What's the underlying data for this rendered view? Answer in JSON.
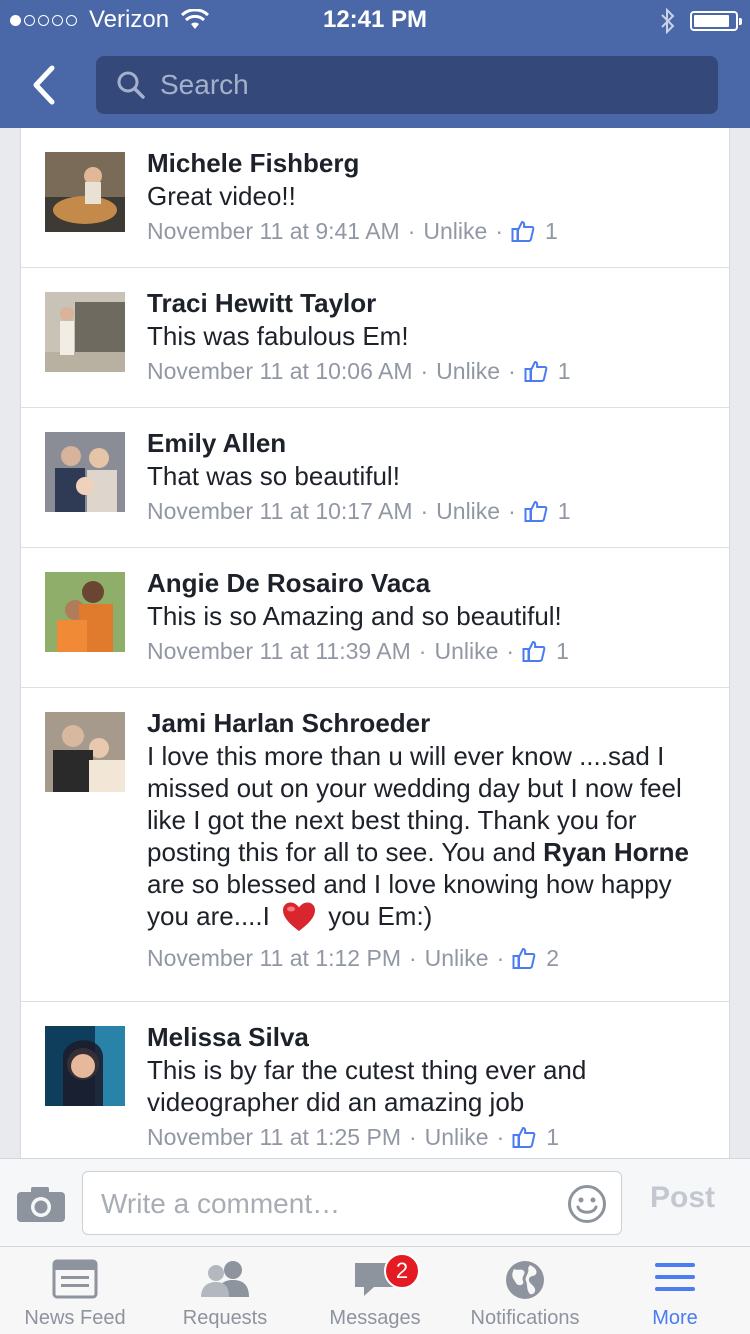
{
  "status_bar": {
    "carrier": "Verizon",
    "time": "12:41 PM",
    "signal_bars": 1,
    "signal_total": 5
  },
  "header": {
    "search_placeholder": "Search"
  },
  "comments": [
    {
      "author": "Michele Fishberg",
      "text": "Great video!!",
      "timestamp": "November 11 at 9:41 AM",
      "action": "Unlike",
      "likes": "1",
      "avatar_colors": [
        "#7a6a58",
        "#c48a4a",
        "#3d3a35"
      ]
    },
    {
      "author": "Traci Hewitt Taylor",
      "text": "This was fabulous Em!",
      "timestamp": "November 11 at 10:06 AM",
      "action": "Unlike",
      "likes": "1",
      "avatar_colors": [
        "#c9c2b6",
        "#e9d7c4",
        "#6e6a60"
      ]
    },
    {
      "author": "Emily Allen",
      "text": "That was so beautiful!",
      "timestamp": "November 11 at 10:17 AM",
      "action": "Unlike",
      "likes": "1",
      "avatar_colors": [
        "#8a8d95",
        "#d6b39a",
        "#2f3a55"
      ]
    },
    {
      "author": "Angie De Rosairo Vaca",
      "text": "This is so Amazing and so beautiful!",
      "timestamp": "November 11 at 11:39 AM",
      "action": "Unlike",
      "likes": "1",
      "avatar_colors": [
        "#8fae6a",
        "#e07a2c",
        "#4a3526"
      ]
    },
    {
      "author": "Jami Harlan Schroeder",
      "text_part1": "I love this more than u will ever know ....sad I missed out on your wedding day but I now feel like I got the next best thing. Thank you for posting this for all to see. You and ",
      "mention": "Ryan Horne",
      "text_part2": " are so blessed and I love knowing how happy you are....I ",
      "text_part3": " you Em:)",
      "timestamp": "November 11 at 1:12 PM",
      "action": "Unlike",
      "likes": "2",
      "avatar_colors": [
        "#a59a8c",
        "#d9b8a0",
        "#2a2a2a"
      ]
    },
    {
      "author": "Melissa Silva",
      "text": "This is by far the cutest thing ever and videographer did an amazing job",
      "timestamp": "November 11 at 1:25 PM",
      "action": "Unlike",
      "likes": "1",
      "avatar_colors": [
        "#0f3d5c",
        "#3bb0d8",
        "#1b1b2a"
      ]
    }
  ],
  "composer": {
    "placeholder": "Write a comment…",
    "post_label": "Post"
  },
  "tabs": [
    {
      "label": "News Feed"
    },
    {
      "label": "Requests"
    },
    {
      "label": "Messages",
      "badge": "2"
    },
    {
      "label": "Notifications"
    },
    {
      "label": "More"
    }
  ],
  "colors": {
    "brand": "#4a68a7",
    "active_tab": "#4b7cf0",
    "like": "#4b7cf0",
    "badge": "#e41b23"
  }
}
